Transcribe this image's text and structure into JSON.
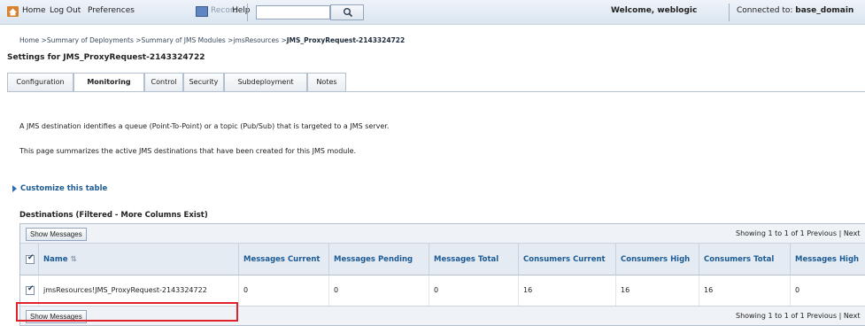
{
  "toolbar": {
    "home": "Home",
    "logout": "Log Out",
    "preferences": "Preferences",
    "record": "Record",
    "help": "Help",
    "search_value": "",
    "welcome": "Welcome, weblogic",
    "connected_prefix": "Connected to:",
    "domain": "base_domain"
  },
  "breadcrumb": {
    "items": [
      "Home",
      "Summary of Deployments",
      "Summary of JMS Modules",
      "jmsResources"
    ],
    "separator": " >",
    "current": "JMS_ProxyRequest-2143324722"
  },
  "settings_title": "Settings for JMS_ProxyRequest-2143324722",
  "tabs": [
    "Configuration",
    "Monitoring",
    "Control",
    "Security",
    "Subdeployment",
    "Notes"
  ],
  "active_tab": "Monitoring",
  "description": [
    "A JMS destination identifies a queue (Point-To-Point) or a topic (Pub/Sub) that is targeted to a JMS server.",
    "This page summarizes the active JMS destinations that have been created for this JMS module."
  ],
  "customize_link": "Customize this table",
  "table": {
    "title": "Destinations (Filtered - More Columns Exist)",
    "show_messages": "Show Messages",
    "paging": "Showing 1 to 1 of 1   Previous | Next",
    "columns": [
      "Name",
      "Messages Current",
      "Messages Pending",
      "Messages Total",
      "Consumers Current",
      "Consumers High",
      "Consumers Total",
      "Messages High"
    ],
    "rows": [
      {
        "checked": true,
        "cells": [
          "jmsResources!JMS_ProxyRequest-2143324722",
          "0",
          "0",
          "0",
          "16",
          "16",
          "16",
          "0"
        ]
      }
    ]
  },
  "colors": {
    "accent": "#1d5b94",
    "highlight": "#e0232a",
    "toolbar": "#dbe5f0"
  },
  "icons": [
    "home-icon",
    "record-icon",
    "search-icon",
    "sort-icon",
    "checkbox-checked-icon",
    "triangle-right-icon"
  ]
}
